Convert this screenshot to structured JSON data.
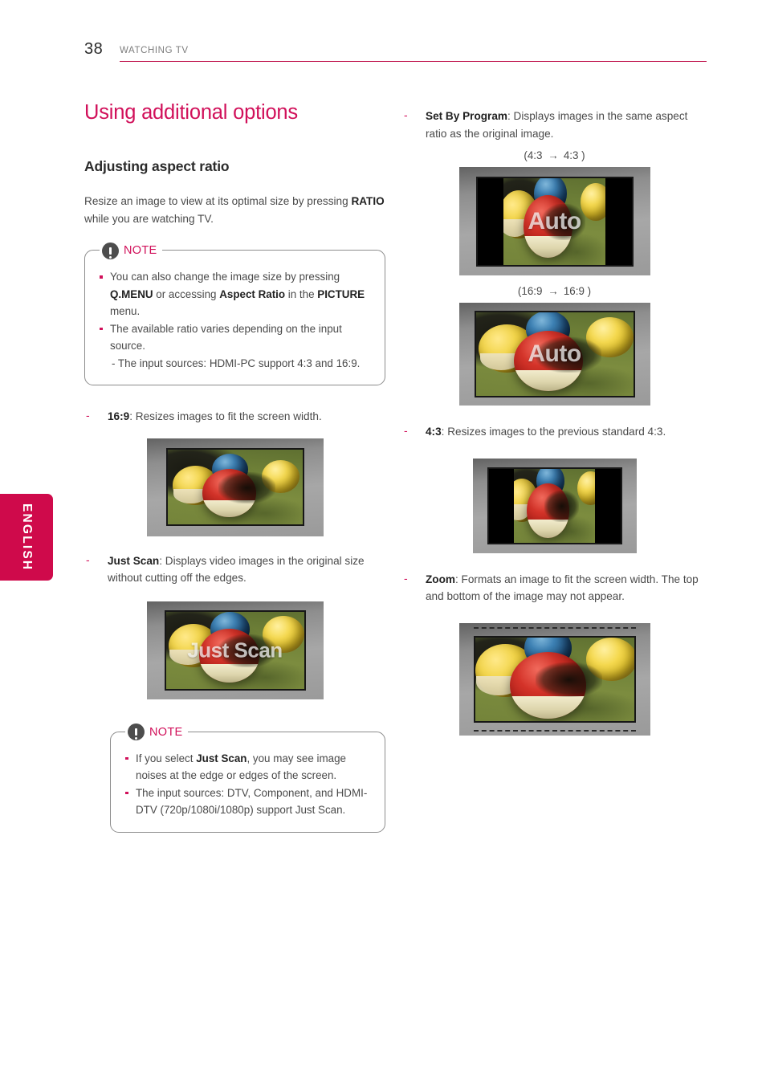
{
  "header": {
    "page_number": "38",
    "section_title": "WATCHING TV",
    "rule_color": "#c0184f"
  },
  "side_tab": {
    "label": "ENGLISH",
    "color": "#cf0a4b"
  },
  "left_column": {
    "title": "Using additional options",
    "subtitle": "Adjusting aspect ratio",
    "intro_1": "Resize an image to view at its optimal size by pressing ",
    "intro_bold": "RATIO",
    "intro_2": " while you are watching TV.",
    "note1": {
      "label": "NOTE",
      "bullet1_a": "You can also change the image size by pressing ",
      "bullet1_b": "Q.MENU",
      "bullet1_c": " or accessing ",
      "bullet1_d": "Aspect Ratio",
      "bullet1_e": " in the ",
      "bullet1_f": "PICTURE",
      "bullet1_g": " menu.",
      "bullet2_a": "The available ratio varies depending on the input source.",
      "bullet2_sub": "- The input sources: HDMI-PC support 4:3 and 16:9."
    },
    "item_169_label": "16:9",
    "item_169_text": ": Resizes images to fit the screen width.",
    "figure_169_overlay": "",
    "item_justscan_label": "Just Scan",
    "item_justscan_text": ": Displays video images in the original size without cutting off the edges.",
    "figure_justscan_overlay": "Just Scan",
    "note2": {
      "label": "NOTE",
      "bullet1_a": "If you select ",
      "bullet1_b": "Just Scan",
      "bullet1_c": ", you may see image noises at the edge or edges of the screen.",
      "bullet2": "The input sources: DTV, Component, and HDMI-DTV (720p/1080i/1080p) support Just Scan."
    }
  },
  "right_column": {
    "item_setbyprogram_label": "Set By Program",
    "item_setbyprogram_text": ": Displays images in the same aspect ratio as the original image.",
    "caption_43": "(4:3",
    "caption_43_end": "4:3 )",
    "caption_169": "(16:9",
    "caption_169_end": "16:9 )",
    "figure_auto_overlay": "Auto",
    "item_43_label": "4:3",
    "item_43_text": ": Resizes images to the previous standard 4:3.",
    "item_zoom_label": "Zoom",
    "item_zoom_text": ": Formats an image to fit the screen width. The top and bottom of the image may not appear.",
    "arrow_glyph": "→"
  },
  "colors": {
    "accent": "#d1105a",
    "rule": "#c0184f",
    "body_text": "#4a4a4a",
    "heading_text": "#2b2b2b"
  }
}
